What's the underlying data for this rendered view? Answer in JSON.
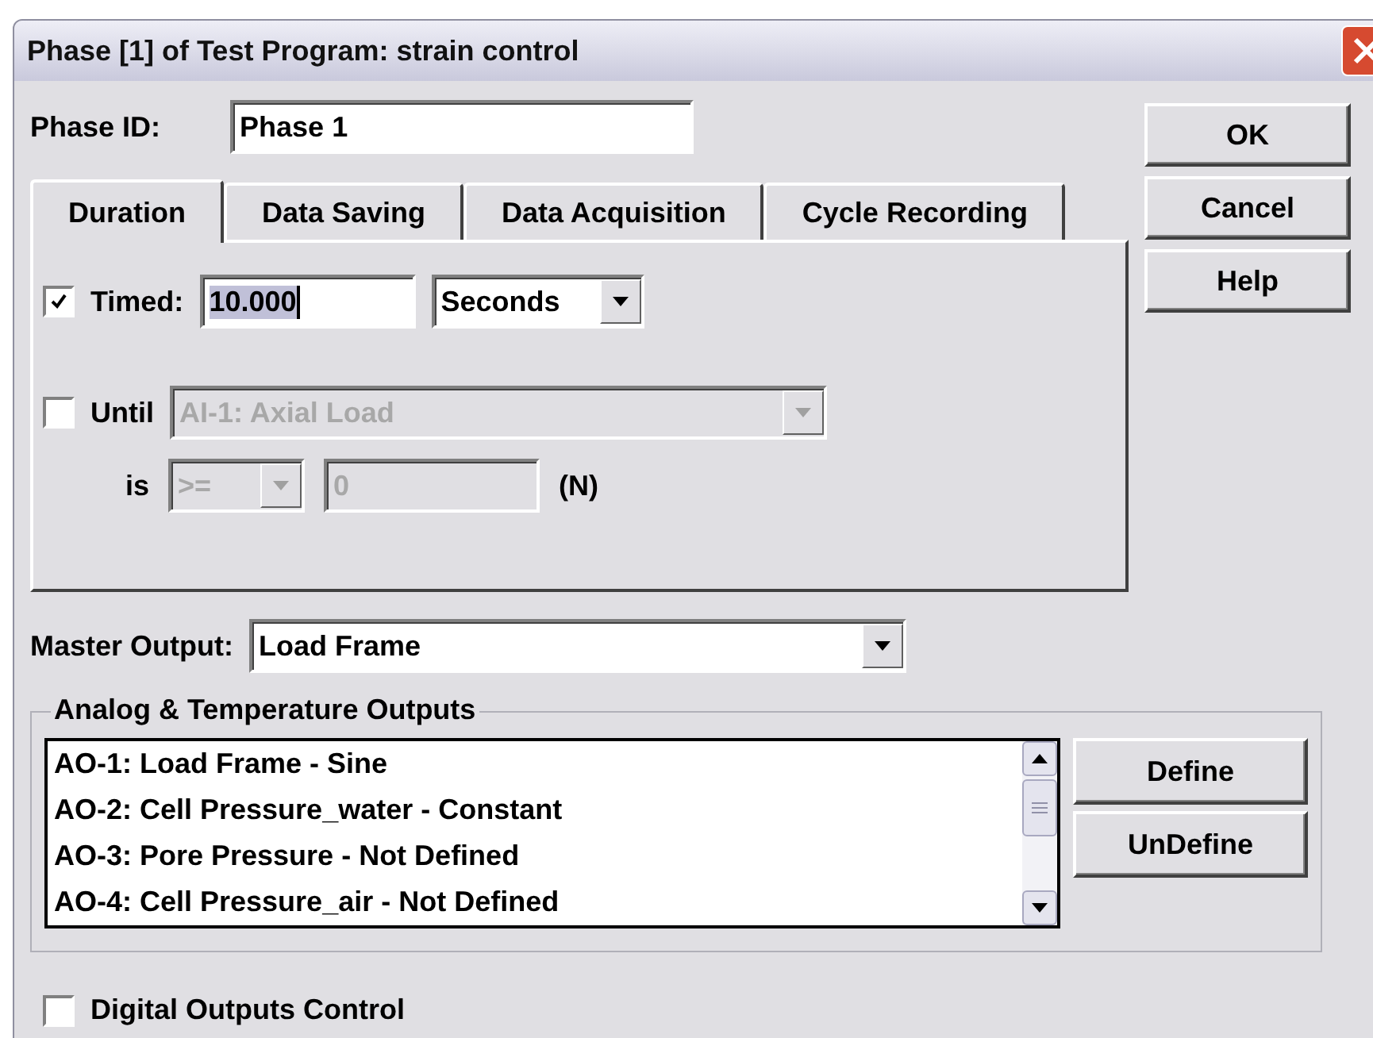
{
  "window": {
    "title": "Phase [1] of Test Program: strain control"
  },
  "phase_id": {
    "label": "Phase ID:",
    "value": "Phase 1"
  },
  "buttons": [
    {
      "label": "OK"
    },
    {
      "label": "Cancel"
    },
    {
      "label": "Help"
    }
  ],
  "tabs": [
    {
      "label": "Duration",
      "selected": true
    },
    {
      "label": "Data Saving",
      "selected": false
    },
    {
      "label": "Data Acquisition",
      "selected": false
    },
    {
      "label": "Cycle Recording",
      "selected": false
    }
  ],
  "timed": {
    "checked": true,
    "label": "Timed:",
    "value": "10.000",
    "text_selected": true,
    "unit": "Seconds"
  },
  "until": {
    "checked": false,
    "label": "Until",
    "channel": "AI-1: Axial Load",
    "disabled": true,
    "is_label": "is",
    "operator": ">=",
    "threshold": "0",
    "unit": "(N)"
  },
  "master_output": {
    "label": "Master Output:",
    "value": "Load Frame"
  },
  "outputs": {
    "title": "Analog & Temperature Outputs",
    "items": [
      {
        "label": "AO-1: Load Frame - Sine"
      },
      {
        "label": "AO-2: Cell Pressure_water - Constant"
      },
      {
        "label": "AO-3: Pore Pressure - Not Defined"
      },
      {
        "label": "AO-4: Cell Pressure_air - Not Defined"
      }
    ],
    "buttons": [
      {
        "label": "Define"
      },
      {
        "label": "UnDefine"
      }
    ]
  },
  "digital_outputs": {
    "checked": false,
    "label": "Digital Outputs Control"
  }
}
